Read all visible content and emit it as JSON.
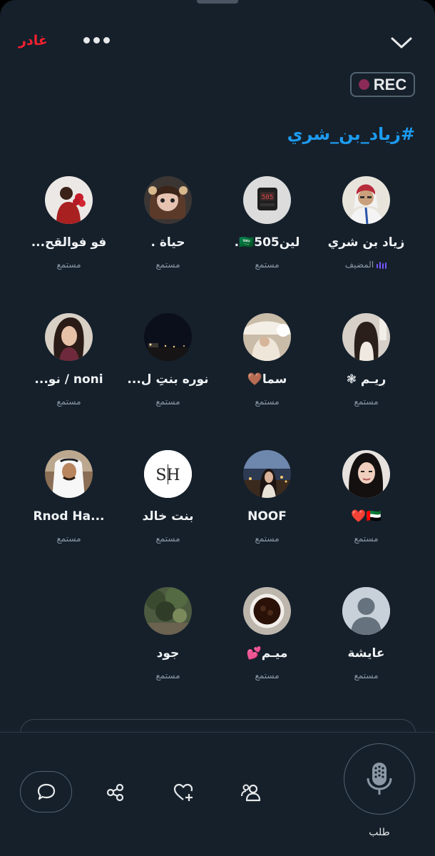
{
  "header": {
    "leave_label": "غادر",
    "rec_label": "REC"
  },
  "space": {
    "title": "#زياد_بن_شري"
  },
  "participants": [
    {
      "name": "زياد بن شري",
      "role": "المضيف"
    },
    {
      "name": "لين🇸🇦505.",
      "role": "مستمع"
    },
    {
      "name": "حياة .",
      "role": "مستمع"
    },
    {
      "name": "فو فوالقح...",
      "role": "مستمع"
    },
    {
      "name": "رِيـم ❃",
      "role": "مستمع"
    },
    {
      "name": "سما🤎",
      "role": "مستمع"
    },
    {
      "name": "نوره بنتِ ل...",
      "role": "مستمع"
    },
    {
      "name": "noni / نو...",
      "role": "مستمع"
    },
    {
      "name": "🇦🇪❤️",
      "role": "مستمع"
    },
    {
      "name": "NOOF",
      "role": "مستمع"
    },
    {
      "name": "بنت خالد",
      "role": "مستمع"
    },
    {
      "name": "Rnod Ha...",
      "role": "مستمع"
    },
    {
      "name": "عايشة",
      "role": "مستمع"
    },
    {
      "name": "ميـم💕",
      "role": "مستمع"
    },
    {
      "name": "جود",
      "role": "مستمع"
    }
  ],
  "avatar_monogram": "SH",
  "bottom": {
    "mic_label": "طلب"
  },
  "colors": {
    "background": "#15202b",
    "accent": "#1d9bf0",
    "leave": "#f4212e",
    "host_bars": "#7856ff"
  }
}
